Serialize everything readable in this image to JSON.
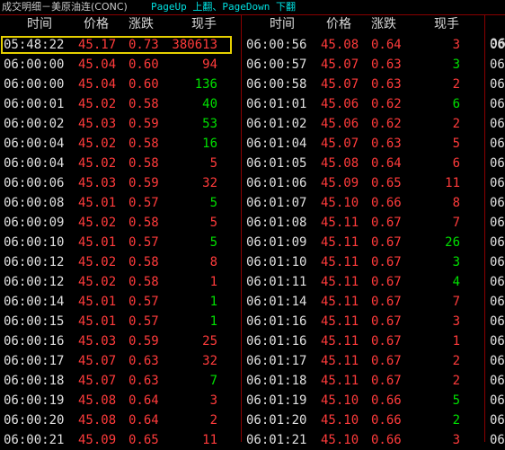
{
  "title": "成交明细－美原油连(CONC)",
  "paging": {
    "up_key": "PageUp",
    "up_text": "上翻",
    "sep": "、",
    "down_key": "PageDown",
    "down_text": "下翻"
  },
  "headers": {
    "time": "时间",
    "price": "价格",
    "change": "涨跌",
    "volume": "现手"
  },
  "third_column_prefix": "06",
  "colors": {
    "up": "#ff3b3b",
    "down_volume": "#00e000",
    "up_volume": "#ff3b3b",
    "highlight": "#ffff40",
    "border": "#e6d000"
  },
  "columns": [
    {
      "rows": [
        {
          "time": "05:48:22",
          "price": "45.17",
          "change": "0.73",
          "volume": "380613",
          "vcolor": "red",
          "highlight": true
        },
        {
          "time": "06:00:00",
          "price": "45.04",
          "change": "0.60",
          "volume": "94",
          "vcolor": "red"
        },
        {
          "time": "06:00:00",
          "price": "45.04",
          "change": "0.60",
          "volume": "136",
          "vcolor": "green"
        },
        {
          "time": "06:00:01",
          "price": "45.02",
          "change": "0.58",
          "volume": "40",
          "vcolor": "green"
        },
        {
          "time": "06:00:02",
          "price": "45.03",
          "change": "0.59",
          "volume": "53",
          "vcolor": "green"
        },
        {
          "time": "06:00:04",
          "price": "45.02",
          "change": "0.58",
          "volume": "16",
          "vcolor": "green"
        },
        {
          "time": "06:00:04",
          "price": "45.02",
          "change": "0.58",
          "volume": "5",
          "vcolor": "red"
        },
        {
          "time": "06:00:06",
          "price": "45.03",
          "change": "0.59",
          "volume": "32",
          "vcolor": "red"
        },
        {
          "time": "06:00:08",
          "price": "45.01",
          "change": "0.57",
          "volume": "5",
          "vcolor": "green"
        },
        {
          "time": "06:00:09",
          "price": "45.02",
          "change": "0.58",
          "volume": "5",
          "vcolor": "red"
        },
        {
          "time": "06:00:10",
          "price": "45.01",
          "change": "0.57",
          "volume": "5",
          "vcolor": "green"
        },
        {
          "time": "06:00:12",
          "price": "45.02",
          "change": "0.58",
          "volume": "8",
          "vcolor": "red"
        },
        {
          "time": "06:00:12",
          "price": "45.02",
          "change": "0.58",
          "volume": "1",
          "vcolor": "red"
        },
        {
          "time": "06:00:14",
          "price": "45.01",
          "change": "0.57",
          "volume": "1",
          "vcolor": "green"
        },
        {
          "time": "06:00:15",
          "price": "45.01",
          "change": "0.57",
          "volume": "1",
          "vcolor": "green"
        },
        {
          "time": "06:00:16",
          "price": "45.03",
          "change": "0.59",
          "volume": "25",
          "vcolor": "red"
        },
        {
          "time": "06:00:17",
          "price": "45.07",
          "change": "0.63",
          "volume": "32",
          "vcolor": "red"
        },
        {
          "time": "06:00:18",
          "price": "45.07",
          "change": "0.63",
          "volume": "7",
          "vcolor": "green"
        },
        {
          "time": "06:00:19",
          "price": "45.08",
          "change": "0.64",
          "volume": "3",
          "vcolor": "red"
        },
        {
          "time": "06:00:20",
          "price": "45.08",
          "change": "0.64",
          "volume": "2",
          "vcolor": "red"
        },
        {
          "time": "06:00:21",
          "price": "45.09",
          "change": "0.65",
          "volume": "11",
          "vcolor": "red"
        }
      ]
    },
    {
      "rows": [
        {
          "time": "06:00:56",
          "price": "45.08",
          "change": "0.64",
          "volume": "3",
          "vcolor": "red"
        },
        {
          "time": "06:00:57",
          "price": "45.07",
          "change": "0.63",
          "volume": "3",
          "vcolor": "green"
        },
        {
          "time": "06:00:58",
          "price": "45.07",
          "change": "0.63",
          "volume": "2",
          "vcolor": "red"
        },
        {
          "time": "06:01:01",
          "price": "45.06",
          "change": "0.62",
          "volume": "6",
          "vcolor": "green"
        },
        {
          "time": "06:01:02",
          "price": "45.06",
          "change": "0.62",
          "volume": "2",
          "vcolor": "red"
        },
        {
          "time": "06:01:04",
          "price": "45.07",
          "change": "0.63",
          "volume": "5",
          "vcolor": "red"
        },
        {
          "time": "06:01:05",
          "price": "45.08",
          "change": "0.64",
          "volume": "6",
          "vcolor": "red"
        },
        {
          "time": "06:01:06",
          "price": "45.09",
          "change": "0.65",
          "volume": "11",
          "vcolor": "red"
        },
        {
          "time": "06:01:07",
          "price": "45.10",
          "change": "0.66",
          "volume": "8",
          "vcolor": "red"
        },
        {
          "time": "06:01:08",
          "price": "45.11",
          "change": "0.67",
          "volume": "7",
          "vcolor": "red"
        },
        {
          "time": "06:01:09",
          "price": "45.11",
          "change": "0.67",
          "volume": "26",
          "vcolor": "green"
        },
        {
          "time": "06:01:10",
          "price": "45.11",
          "change": "0.67",
          "volume": "3",
          "vcolor": "green"
        },
        {
          "time": "06:01:11",
          "price": "45.11",
          "change": "0.67",
          "volume": "4",
          "vcolor": "green"
        },
        {
          "time": "06:01:14",
          "price": "45.11",
          "change": "0.67",
          "volume": "7",
          "vcolor": "red"
        },
        {
          "time": "06:01:16",
          "price": "45.11",
          "change": "0.67",
          "volume": "3",
          "vcolor": "red"
        },
        {
          "time": "06:01:16",
          "price": "45.11",
          "change": "0.67",
          "volume": "1",
          "vcolor": "red"
        },
        {
          "time": "06:01:17",
          "price": "45.11",
          "change": "0.67",
          "volume": "2",
          "vcolor": "red"
        },
        {
          "time": "06:01:18",
          "price": "45.11",
          "change": "0.67",
          "volume": "2",
          "vcolor": "red"
        },
        {
          "time": "06:01:19",
          "price": "45.10",
          "change": "0.66",
          "volume": "5",
          "vcolor": "green"
        },
        {
          "time": "06:01:20",
          "price": "45.10",
          "change": "0.66",
          "volume": "2",
          "vcolor": "green"
        },
        {
          "time": "06:01:21",
          "price": "45.10",
          "change": "0.66",
          "volume": "3",
          "vcolor": "red"
        }
      ]
    }
  ]
}
